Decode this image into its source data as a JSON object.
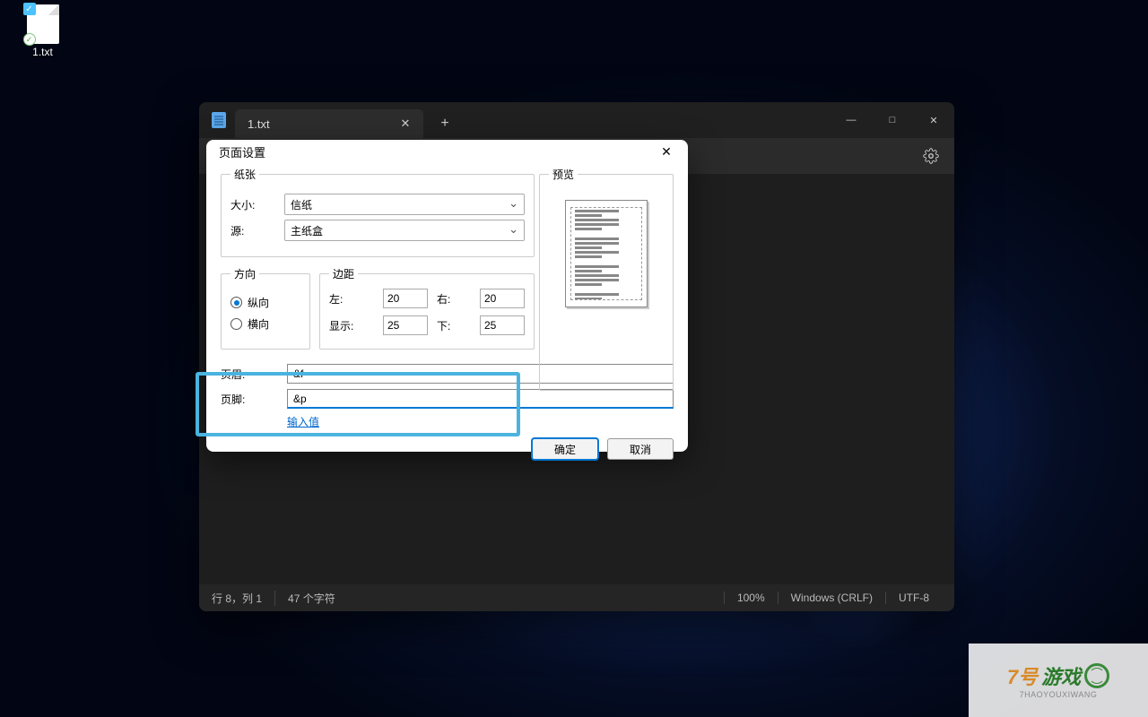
{
  "desktop": {
    "icon_label": "1.txt"
  },
  "notepad": {
    "tab_title": "1.txt",
    "window_controls": {
      "min": "—",
      "max": "□",
      "close": "✕"
    },
    "statusbar": {
      "position": "行 8，列 1",
      "chars": "47 个字符",
      "zoom": "100%",
      "line_ending": "Windows (CRLF)",
      "encoding": "UTF-8"
    }
  },
  "dialog": {
    "title": "页面设置",
    "paper": {
      "legend": "纸张",
      "size_label": "大小:",
      "size_value": "信纸",
      "source_label": "源:",
      "source_value": "主纸盒"
    },
    "orientation": {
      "legend": "方向",
      "portrait": "纵向",
      "landscape": "横向",
      "selected": "portrait"
    },
    "margins": {
      "legend": "边距",
      "left_label": "左:",
      "left_value": "20",
      "right_label": "右:",
      "right_value": "20",
      "top_label": "显示:",
      "top_value": "25",
      "bottom_label": "下:",
      "bottom_value": "25"
    },
    "preview": {
      "legend": "预览"
    },
    "header": {
      "label": "页眉:",
      "value": "&f"
    },
    "footer": {
      "label": "页脚:",
      "value": "&p"
    },
    "input_values_link": "输入值",
    "buttons": {
      "ok": "确定",
      "cancel": "取消"
    }
  },
  "watermark": {
    "main": "7号游戏网",
    "sub": "7HAOYOUXIWANG"
  }
}
